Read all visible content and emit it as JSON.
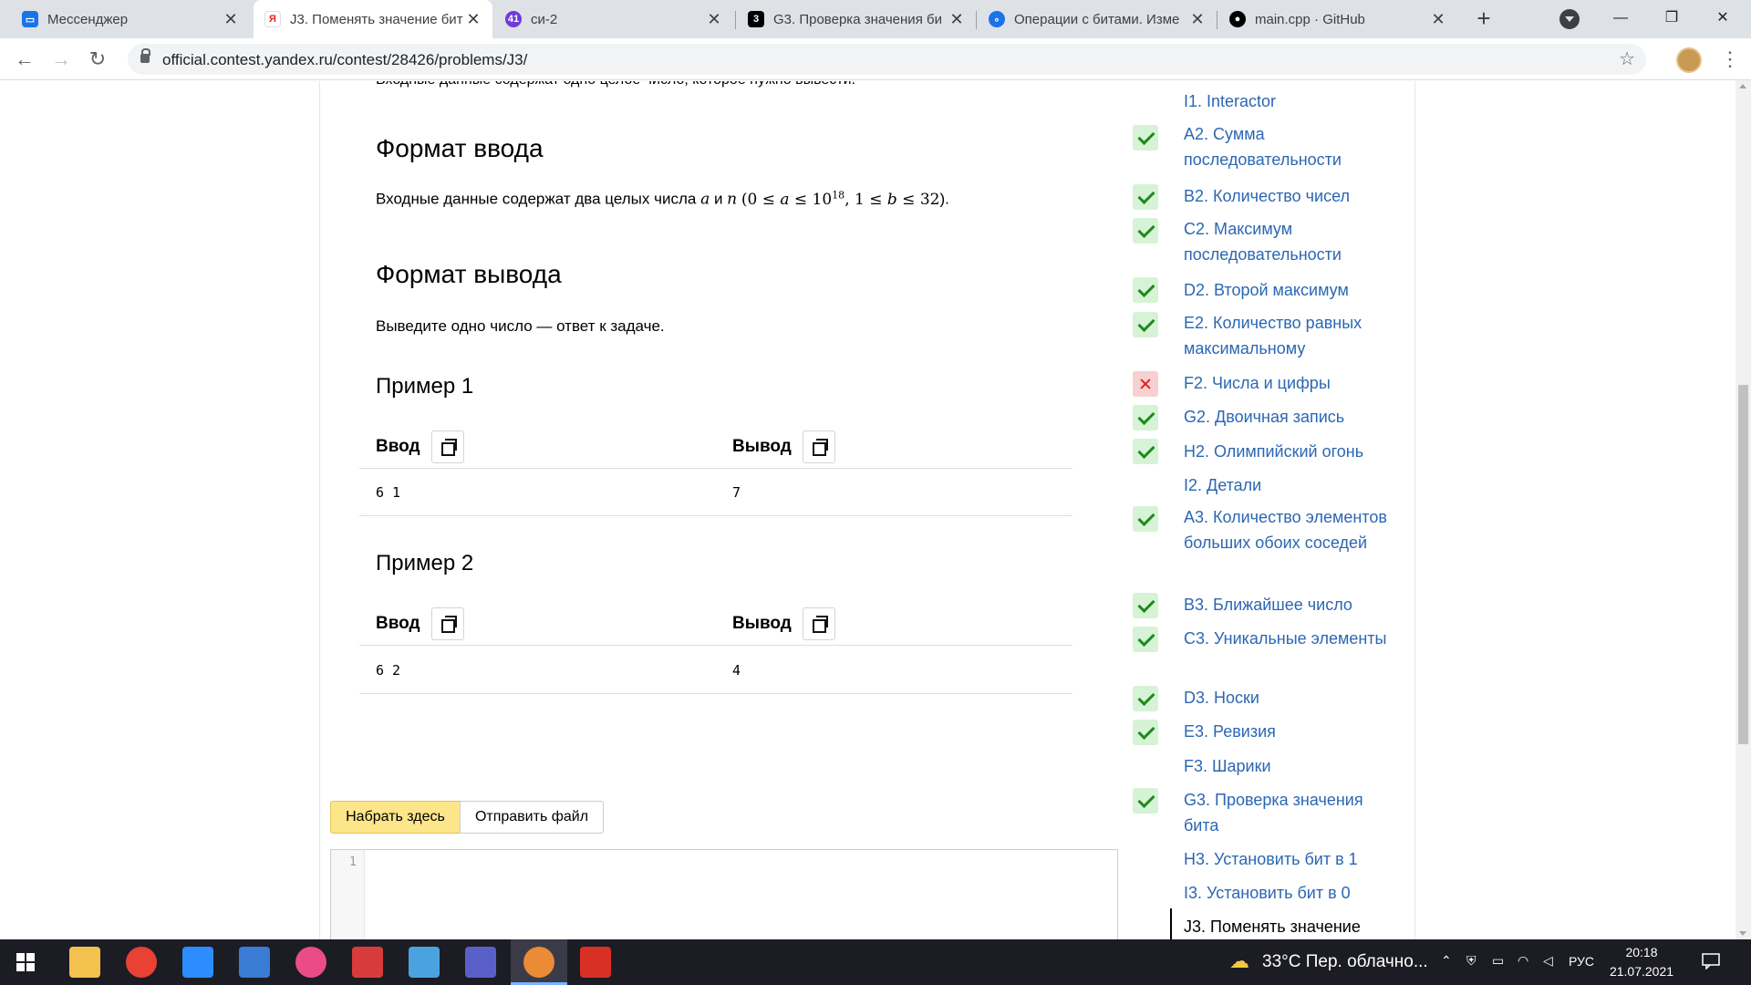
{
  "browser": {
    "tabs": [
      {
        "title": "Мессенджер",
        "active": false,
        "color": "#1a73e8"
      },
      {
        "title": "J3. Поменять значение бит",
        "active": true,
        "color": "#ffffff"
      },
      {
        "title": "си-2",
        "active": false,
        "color": "#6f3bd8",
        "badge": "41"
      },
      {
        "title": "G3. Проверка значения би",
        "active": false,
        "color": "#000000"
      },
      {
        "title": "Операции с битами. Изме",
        "active": false,
        "color": "#1a73e8"
      },
      {
        "title": "main.cpp · GitHub",
        "active": false,
        "color": "#000000"
      }
    ],
    "close_glyph": "✕",
    "new_tab_glyph": "+",
    "url": "official.contest.yandex.ru/contest/28426/problems/J3/",
    "back_glyph": "←",
    "forward_glyph": "→",
    "reload_glyph": "↻",
    "bookmark_glyph": "☆",
    "menu_glyph": "⋮",
    "win_minimize": "—",
    "win_restore": "❐",
    "win_close": "✕"
  },
  "problem": {
    "top_cut_text": "Входные данные содержат одно целое число, которое нужно вывести.",
    "input_format": {
      "heading": "Формат ввода",
      "text_before": "Входные данные содержат два целых числа",
      "var_a": "a",
      "conj": "и",
      "var_n": "n",
      "constraint_open": "(0 ≤ ",
      "c_a": "a",
      "c_le": " ≤ 10",
      "c_exp": "18",
      "c_mid": ", 1 ≤ ",
      "c_b": "b",
      "c_end": " ≤ 32",
      "constraint_close": ")."
    },
    "output_format": {
      "heading": "Формат вывода",
      "text": "Выведите одно число — ответ к задаче."
    },
    "examples": [
      {
        "title": "Пример 1",
        "input_label": "Ввод",
        "output_label": "Вывод",
        "input": "6 1",
        "output": "7"
      },
      {
        "title": "Пример 2",
        "input_label": "Ввод",
        "output_label": "Вывод",
        "input": "6 2",
        "output": "4"
      }
    ],
    "submit": {
      "type_here": "Набрать здесь",
      "send_file": "Отправить файл",
      "line_number": "1"
    }
  },
  "problems_sidebar": [
    {
      "label": "I1. Interactor",
      "status": "none"
    },
    {
      "label": "A2. Сумма последовательности",
      "status": "ok"
    },
    {
      "label": "B2. Количество чисел",
      "status": "ok"
    },
    {
      "label": "C2. Максимум последовательности",
      "status": "ok"
    },
    {
      "label": "D2. Второй максимум",
      "status": "ok"
    },
    {
      "label": "E2. Количество равных максимальному",
      "status": "ok"
    },
    {
      "label": "F2. Числа и цифры",
      "status": "fail"
    },
    {
      "label": "G2. Двоичная запись",
      "status": "ok"
    },
    {
      "label": "H2. Олимпийский огонь",
      "status": "ok"
    },
    {
      "label": "I2. Детали",
      "status": "none"
    },
    {
      "label": "A3. Количество элементов больших обоих соседей",
      "status": "ok"
    },
    {
      "label": "B3. Ближайшее число",
      "status": "ok"
    },
    {
      "label": "C3. Уникальные элементы",
      "status": "ok"
    },
    {
      "label": "D3. Носки",
      "status": "ok"
    },
    {
      "label": "E3. Ревизия",
      "status": "ok"
    },
    {
      "label": "F3. Шарики",
      "status": "none"
    },
    {
      "label": "G3. Проверка значения бита",
      "status": "ok"
    },
    {
      "label": "H3. Установить бит в 1",
      "status": "none"
    },
    {
      "label": "I3. Установить бит в 0",
      "status": "none"
    },
    {
      "label": "J3. Поменять значение",
      "status": "current"
    }
  ],
  "taskbar": {
    "weather": "33°C  Пер. облачно...",
    "language": "РУС",
    "time": "20:18",
    "date": "21.07.2021",
    "apps": [
      {
        "name": "file-explorer",
        "color": "#f2c14e"
      },
      {
        "name": "chrome",
        "color": "#e94235"
      },
      {
        "name": "zoom",
        "color": "#2d8cff"
      },
      {
        "name": "calculator",
        "color": "#3a7bd5"
      },
      {
        "name": "itunes",
        "color": "#ea4c89"
      },
      {
        "name": "mail",
        "color": "#d83b3b"
      },
      {
        "name": "photos",
        "color": "#4aa3df"
      },
      {
        "name": "presentation",
        "color": "#5860c8"
      },
      {
        "name": "chrome-profile",
        "color": "#ea8b35"
      },
      {
        "name": "app-grid",
        "color": "#d93025"
      }
    ]
  },
  "colors": {
    "link": "#2b67b3",
    "accepted_bg": "#d6f3d6",
    "accepted_check": "#1e8a1e",
    "failed_bg": "#f8d0d0",
    "failed_cross": "#dd2222",
    "type_here_button": "#fde58a"
  }
}
